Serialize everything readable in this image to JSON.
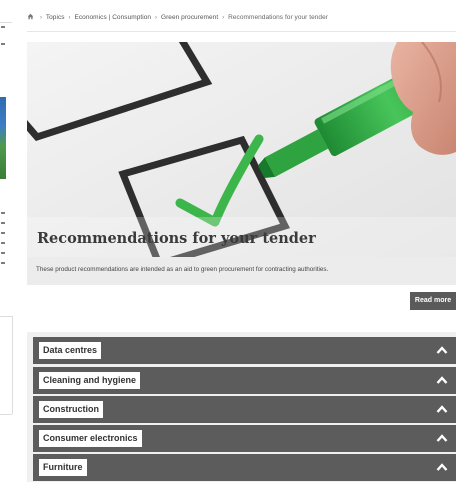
{
  "breadcrumb": {
    "items": [
      "Topics",
      "Economics | Consumption",
      "Green procurement",
      "Recommendations for your tender"
    ],
    "separator": "›"
  },
  "hero": {
    "title": "Recommendations for your tender"
  },
  "intro": {
    "text": "These product recommendations are intended as an aid to green procurement for contracting authorities."
  },
  "read_more_label": "Read more",
  "accordion": {
    "items": [
      {
        "label": "Data centres",
        "icon": "chevron-up-icon"
      },
      {
        "label": "Cleaning and hygiene",
        "icon": "chevron-up-icon"
      },
      {
        "label": "Construction",
        "icon": "chevron-up-icon"
      },
      {
        "label": "Consumer electronics",
        "icon": "chevron-up-icon"
      },
      {
        "label": "Furniture",
        "icon": "chevron-up-icon"
      }
    ]
  },
  "colors": {
    "accordion_bar": "#5c5c5c",
    "intro_band": "#ececec",
    "checkmark_green": "#3cb54a",
    "marker_green": "#2ea33f"
  }
}
